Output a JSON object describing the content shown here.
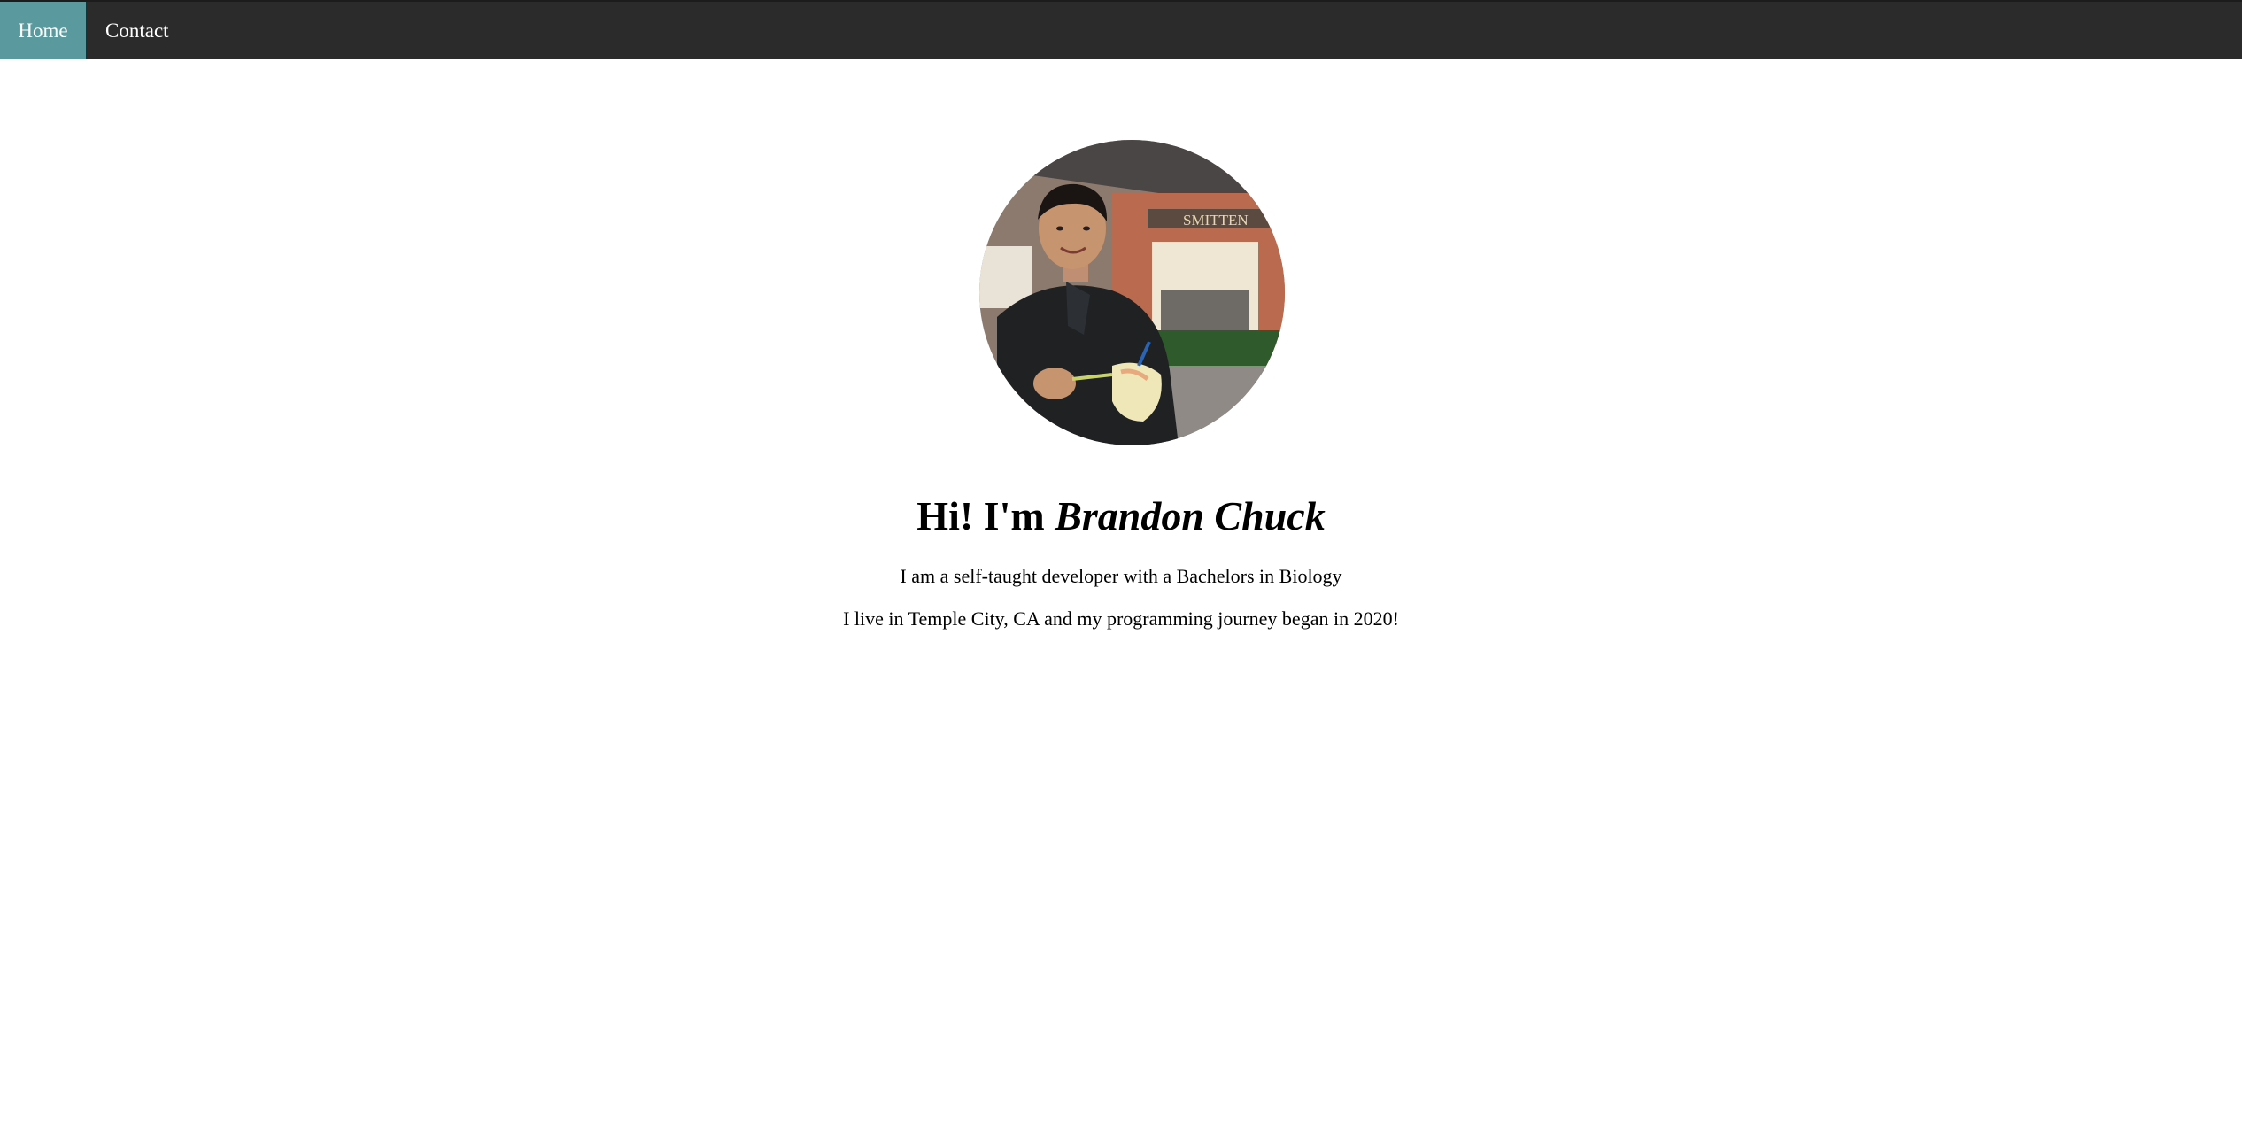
{
  "nav": {
    "items": [
      {
        "label": "Home",
        "active": true
      },
      {
        "label": "Contact",
        "active": false
      }
    ],
    "background": "#2b2b2b",
    "active_color": "#5a9a9e"
  },
  "profile": {
    "image": "profile-photo"
  },
  "intro": {
    "greeting": "Hi! I'm ",
    "name": "Brandon Chuck",
    "line1": "I am a self-taught developer with a Bachelors in Biology",
    "line2": "I live in Temple City, CA and my programming journey began in 2020!"
  }
}
